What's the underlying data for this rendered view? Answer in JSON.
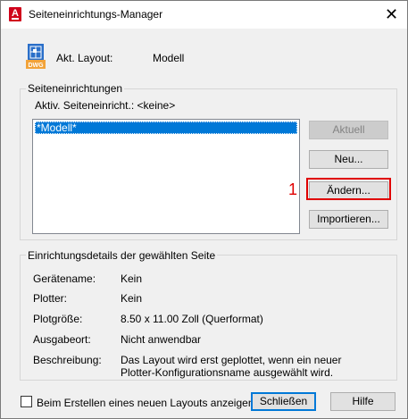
{
  "window": {
    "title": "Seiteneinrichtungs-Manager",
    "close_glyph": "✕",
    "app_icon_letter": "A"
  },
  "layout": {
    "label": "Akt. Layout:",
    "value": "Modell",
    "icon": "dwg-file-icon",
    "icon_text": "DWG"
  },
  "page_setups": {
    "group_label": "Seiteneinrichtungen",
    "active_label": "Aktiv. Seiteneinricht.:",
    "active_value": "<keine>",
    "items": [
      "*Modell*"
    ],
    "selected_index": 0
  },
  "buttons": {
    "current": "Aktuell",
    "new": "Neu...",
    "modify": "Ändern...",
    "import": "Importieren...",
    "close": "Schließen",
    "help": "Hilfe"
  },
  "annotation": {
    "callout_number": "1",
    "color": "#e00000"
  },
  "details": {
    "group_label": "Einrichtungsdetails der gewählten Seite",
    "rows": [
      {
        "label": "Gerätename:",
        "value": "Kein"
      },
      {
        "label": "Plotter:",
        "value": "Kein"
      },
      {
        "label": "Plotgröße:",
        "value": "8.50 x 11.00 Zoll (Querformat)"
      },
      {
        "label": "Ausgabeort:",
        "value": "Nicht anwendbar"
      },
      {
        "label": "Beschreibung:",
        "value": "Das Layout wird erst geplottet, wenn ein neuer",
        "value2": "Plotter-Konfigurationsname ausgewählt wird."
      }
    ]
  },
  "footer": {
    "checkbox_label": "Beim Erstellen eines neuen Layouts anzeigen",
    "checked": false
  },
  "colors": {
    "selection": "#0078d7",
    "accent_red": "#d0021b"
  }
}
